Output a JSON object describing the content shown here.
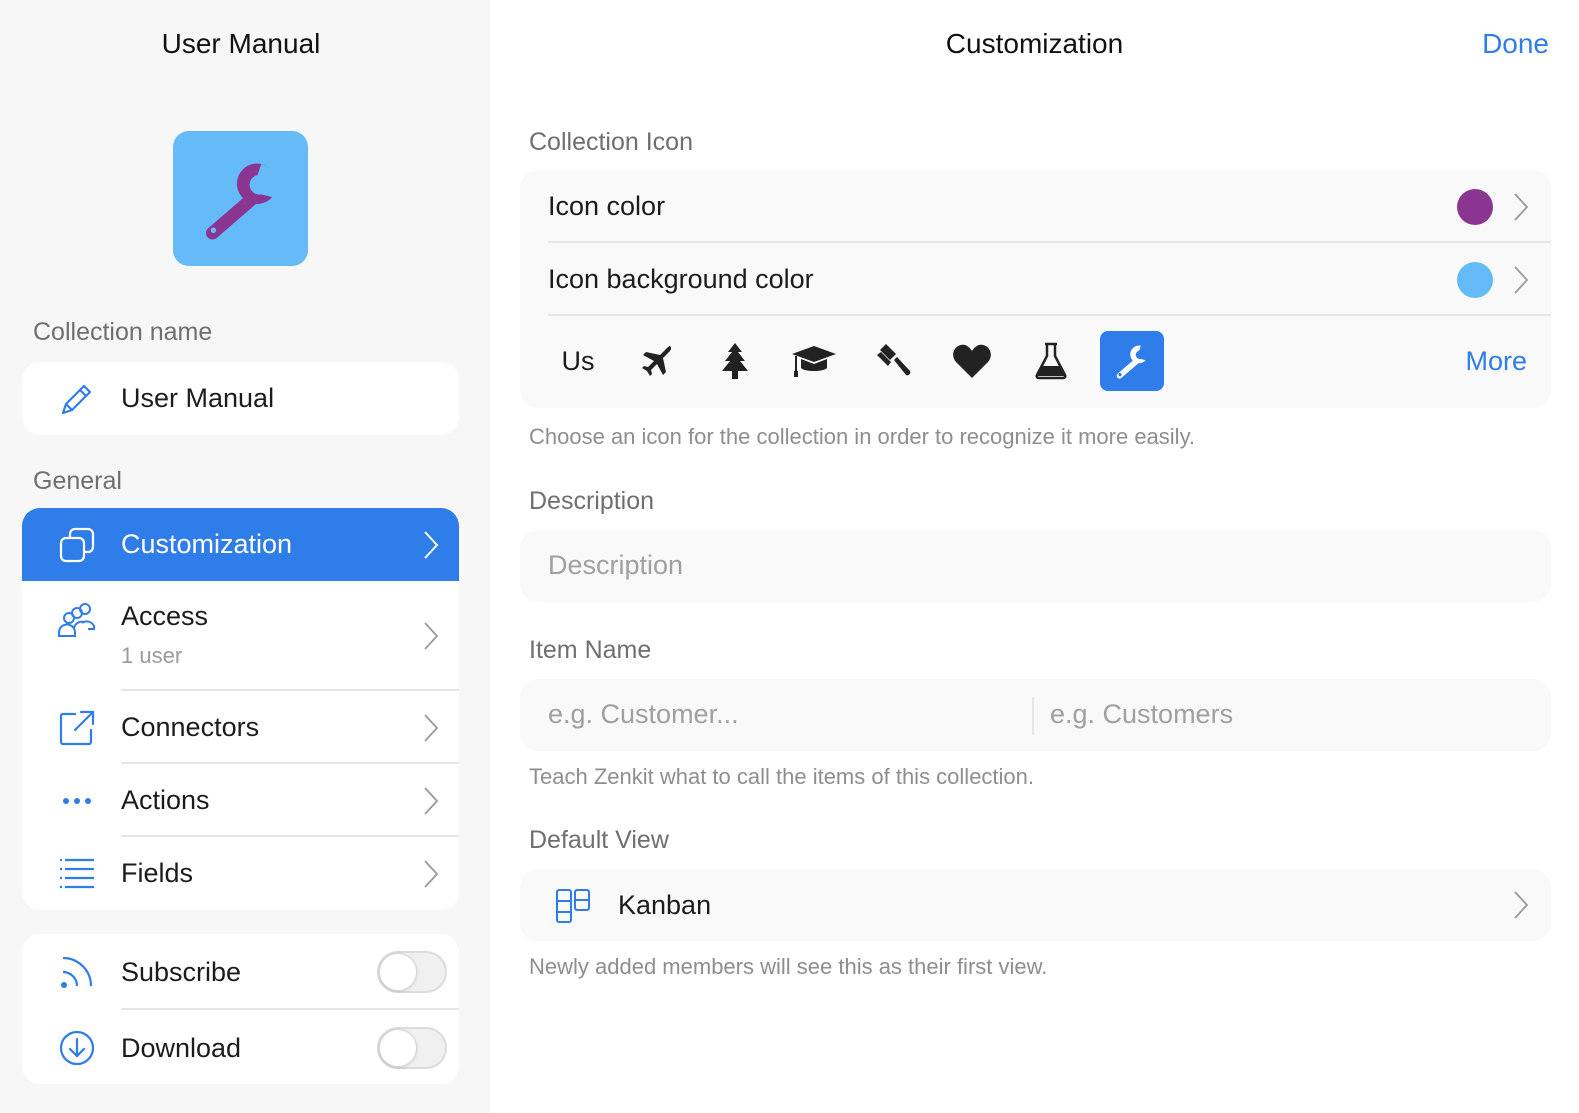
{
  "sidebar": {
    "title": "User Manual",
    "collection_icon": {
      "icon": "wrench-icon",
      "icon_color": "#8b3592",
      "background_color": "#64bbf7"
    },
    "collection_name_label": "Collection name",
    "collection_name_value": "User Manual",
    "general_label": "General",
    "items": [
      {
        "label": "Customization",
        "icon": "overlapping-squares-icon",
        "active": true
      },
      {
        "label": "Access",
        "sublabel": "1 user",
        "icon": "users-icon"
      },
      {
        "label": "Connectors",
        "icon": "external-link-icon"
      },
      {
        "label": "Actions",
        "icon": "ellipsis-icon"
      },
      {
        "label": "Fields",
        "icon": "list-icon"
      }
    ],
    "toggles": [
      {
        "label": "Subscribe",
        "icon": "rss-icon",
        "on": false
      },
      {
        "label": "Download",
        "icon": "download-circle-icon",
        "on": false
      }
    ]
  },
  "main": {
    "title": "Customization",
    "done_label": "Done",
    "collection_icon_label": "Collection Icon",
    "icon_color_label": "Icon color",
    "icon_color_value": "#8b3592",
    "icon_bg_color_label": "Icon background color",
    "icon_bg_color_value": "#64bbf7",
    "icon_choices": [
      {
        "type": "text",
        "label": "Us"
      },
      {
        "type": "icon",
        "icon": "airplane-icon"
      },
      {
        "type": "icon",
        "icon": "tree-icon"
      },
      {
        "type": "icon",
        "icon": "graduation-cap-icon"
      },
      {
        "type": "icon",
        "icon": "gavel-icon"
      },
      {
        "type": "icon",
        "icon": "heart-icon"
      },
      {
        "type": "icon",
        "icon": "flask-icon"
      },
      {
        "type": "icon",
        "icon": "wrench-icon",
        "selected": true
      }
    ],
    "more_label": "More",
    "icon_hint": "Choose an icon for the collection in order to recognize it more easily.",
    "description_label": "Description",
    "description_placeholder": "Description",
    "item_name_label": "Item Name",
    "item_name_singular_placeholder": "e.g. Customer...",
    "item_name_plural_placeholder": "e.g. Customers",
    "item_name_hint": "Teach Zenkit what to call the items of this collection.",
    "default_view_label": "Default View",
    "default_view_value": "Kanban",
    "default_view_icon": "kanban-icon",
    "default_view_hint": "Newly added members will see this as their first view."
  },
  "colors": {
    "accent": "#2f7de8",
    "sidebar_bg": "#f7f7f7",
    "card_bg": "#f9f9f9"
  }
}
